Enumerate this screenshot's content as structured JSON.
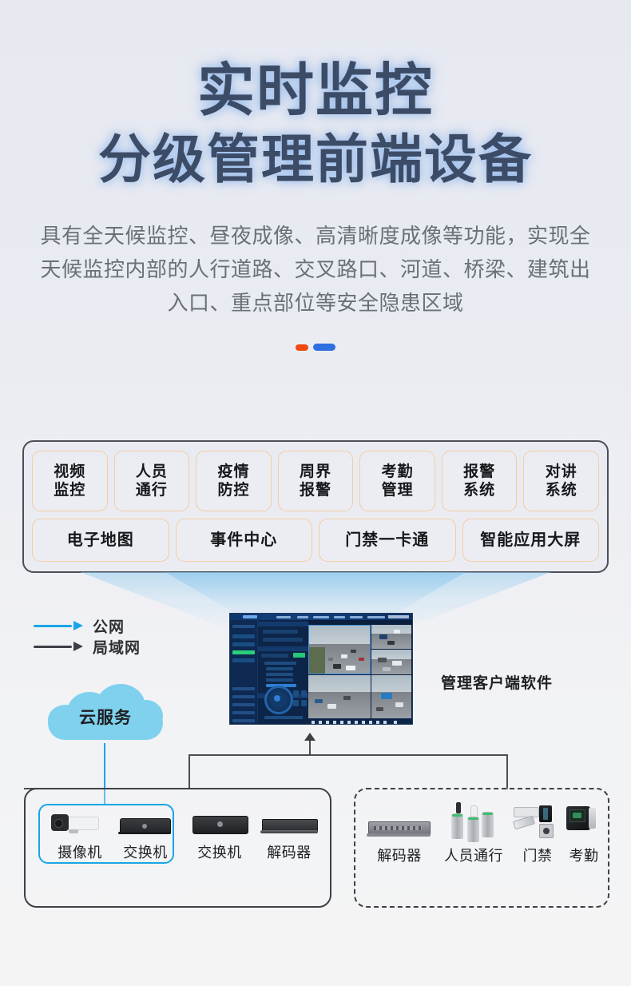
{
  "hero": {
    "title_line1": "实时监控",
    "title_line2": "分级管理前端设备",
    "subtitle": "具有全天候监控、昼夜成像、高清晰度成像等功能，实现全天候监控内部的人行道路、交叉路口、河道、桥梁、建筑出入口、重点部位等安全隐患区域",
    "accent_orange": "#f0490f",
    "accent_blue": "#2f6fe0",
    "title_color": "#3d4c66"
  },
  "features": {
    "row1": [
      {
        "line1": "视频",
        "line2": "监控"
      },
      {
        "line1": "人员",
        "line2": "通行"
      },
      {
        "line1": "疫情",
        "line2": "防控"
      },
      {
        "line1": "周界",
        "line2": "报警"
      },
      {
        "line1": "考勤",
        "line2": "管理"
      },
      {
        "line1": "报警",
        "line2": "系统"
      },
      {
        "line1": "对讲",
        "line2": "系统"
      }
    ],
    "row2": [
      {
        "label": "电子地图"
      },
      {
        "label": "事件中心"
      },
      {
        "label": "门禁一卡通"
      },
      {
        "label": "智能应用大屏"
      }
    ],
    "border_color": "#f2cda2"
  },
  "legend": [
    {
      "label": "公网",
      "color": "#18a5e6"
    },
    {
      "label": "局域网",
      "color": "#3c3f45"
    }
  ],
  "cloud": {
    "label": "云服务",
    "color": "#7fd1ed"
  },
  "client": {
    "label": "管理客户端软件"
  },
  "topology": {
    "left_box": {
      "highlight_color": "#18a5e6",
      "devices": [
        {
          "name": "摄像机",
          "icon": "bullet-camera-icon",
          "highlighted": true
        },
        {
          "name": "交换机",
          "icon": "switch-icon",
          "highlighted": true
        },
        {
          "name": "交换机",
          "icon": "switch-icon",
          "highlighted": false
        },
        {
          "name": "解码器",
          "icon": "decoder-icon",
          "highlighted": false
        }
      ]
    },
    "right_box": {
      "devices": [
        {
          "name": "解码器",
          "icon": "decoder-rack-icon"
        },
        {
          "name": "人员通行",
          "icon": "turnstile-icon"
        },
        {
          "name": "门禁",
          "icon": "access-control-icon"
        },
        {
          "name": "考勤",
          "icon": "attendance-terminal-icon"
        }
      ]
    }
  }
}
